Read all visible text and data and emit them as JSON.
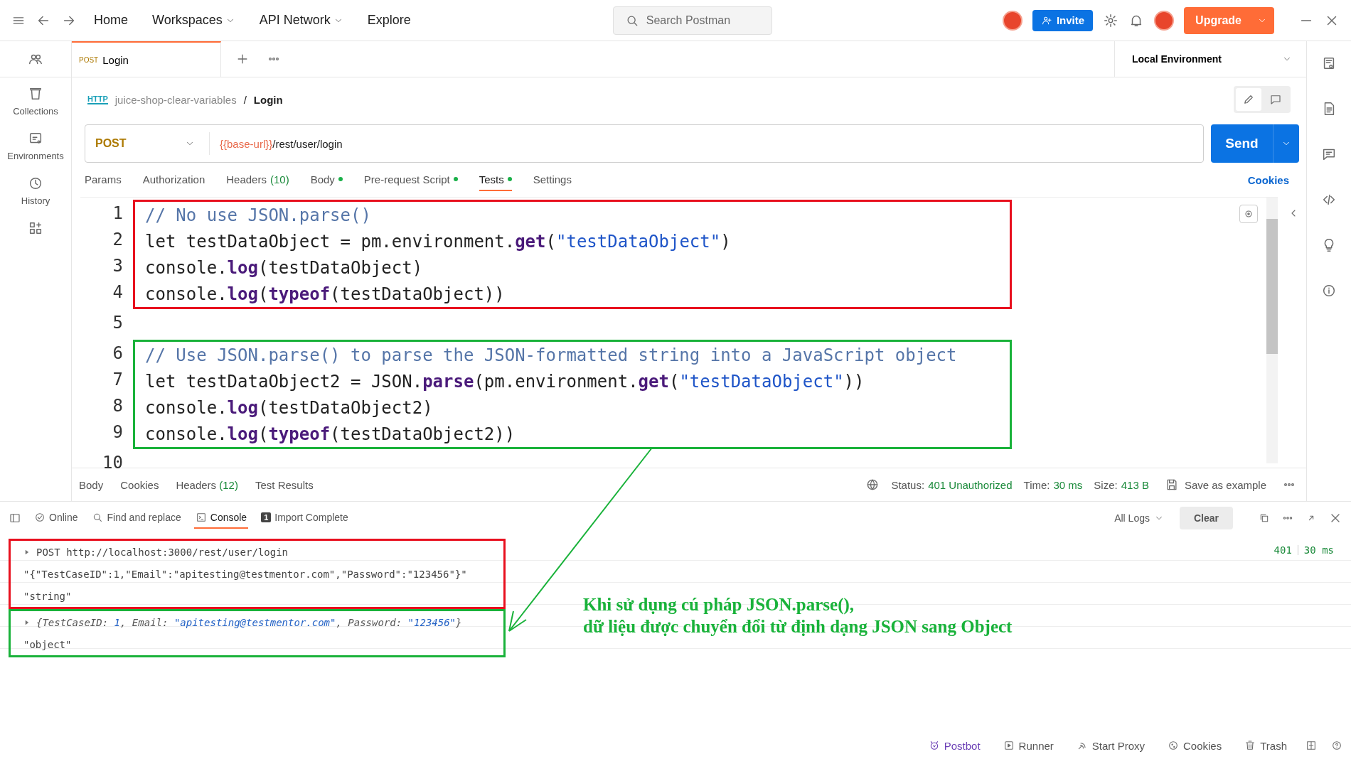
{
  "top_bar": {
    "nav": [
      {
        "label": "Home",
        "dropdown": false
      },
      {
        "label": "Workspaces",
        "dropdown": true
      },
      {
        "label": "API Network",
        "dropdown": true
      },
      {
        "label": "Explore",
        "dropdown": false
      }
    ],
    "search": {
      "placeholder": "Search Postman"
    },
    "invite": "Invite",
    "upgrade": "Upgrade"
  },
  "sidebar": {
    "items": [
      {
        "label": "Collections"
      },
      {
        "label": "Environments"
      },
      {
        "label": "History"
      }
    ]
  },
  "tabs": [
    {
      "method": "POST",
      "name": "Login",
      "selected": true
    }
  ],
  "environment": "Local Environment",
  "breadcrumb": {
    "protocol": "HTTP",
    "items": [
      "juice-shop-clear-variables",
      "Login"
    ],
    "separator": "/"
  },
  "request": {
    "method": "POST",
    "url": [
      {
        "text": "{{base-url}}",
        "kind": "variable"
      },
      {
        "text": "/rest/user/login",
        "kind": "path"
      }
    ],
    "send": "Send"
  },
  "request_tabs": [
    {
      "label": "Params",
      "selected": false,
      "indicator": false
    },
    {
      "label": "Authorization",
      "selected": false,
      "indicator": false
    },
    {
      "label": "Headers",
      "count": "(10)",
      "selected": false,
      "indicator": false
    },
    {
      "label": "Body",
      "selected": false,
      "indicator": true
    },
    {
      "label": "Pre-request Script",
      "selected": false,
      "indicator": true
    },
    {
      "label": "Tests",
      "selected": true,
      "indicator": true
    },
    {
      "label": "Settings",
      "selected": false,
      "indicator": false
    }
  ],
  "cookies_link": "Cookies",
  "editor": {
    "blocks": [
      {
        "color": "#e8101e",
        "lines": [
          {
            "number": "1",
            "segments": [
              {
                "text": "// No use JSON.parse()",
                "kind": "comment"
              }
            ]
          },
          {
            "number": "2",
            "segments": [
              {
                "text": "let testDataObject = pm.environment.",
                "kind": "plain"
              },
              {
                "text": "get",
                "kind": "method"
              },
              {
                "text": "(",
                "kind": "plain"
              },
              {
                "text": "\"testDataObject\"",
                "kind": "string"
              },
              {
                "text": ")",
                "kind": "plain"
              }
            ]
          },
          {
            "number": "3",
            "segments": [
              {
                "text": "console.",
                "kind": "plain"
              },
              {
                "text": "log",
                "kind": "method"
              },
              {
                "text": "(testDataObject)",
                "kind": "plain"
              }
            ]
          },
          {
            "number": "4",
            "segments": [
              {
                "text": "console.",
                "kind": "plain"
              },
              {
                "text": "log",
                "kind": "method"
              },
              {
                "text": "(",
                "kind": "plain"
              },
              {
                "text": "typeof",
                "kind": "method"
              },
              {
                "text": "(testDataObject))",
                "kind": "plain"
              }
            ]
          }
        ]
      },
      {
        "lines": [
          {
            "number": "5"
          }
        ]
      },
      {
        "color": "#19b23a",
        "lines": [
          {
            "number": "6",
            "segments": [
              {
                "text": "// Use JSON.parse() to parse the JSON-formatted string into a JavaScript object",
                "kind": "comment"
              }
            ]
          },
          {
            "number": "7",
            "segments": [
              {
                "text": "let testDataObject2 = JSON.",
                "kind": "plain"
              },
              {
                "text": "parse",
                "kind": "method"
              },
              {
                "text": "(pm.environment.",
                "kind": "plain"
              },
              {
                "text": "get",
                "kind": "method"
              },
              {
                "text": "(",
                "kind": "plain"
              },
              {
                "text": "\"testDataObject\"",
                "kind": "string"
              },
              {
                "text": "))",
                "kind": "plain"
              }
            ]
          },
          {
            "number": "8",
            "segments": [
              {
                "text": "console.",
                "kind": "plain"
              },
              {
                "text": "log",
                "kind": "method"
              },
              {
                "text": "(testDataObject2)",
                "kind": "plain"
              }
            ]
          },
          {
            "number": "9",
            "segments": [
              {
                "text": "console.",
                "kind": "plain"
              },
              {
                "text": "log",
                "kind": "method"
              },
              {
                "text": "(",
                "kind": "plain"
              },
              {
                "text": "typeof",
                "kind": "method"
              },
              {
                "text": "(testDataObject2))",
                "kind": "plain"
              }
            ]
          }
        ]
      },
      {
        "lines": [
          {
            "number": "10"
          }
        ]
      }
    ]
  },
  "response": {
    "tabs": [
      {
        "label": "Body"
      },
      {
        "label": "Cookies"
      },
      {
        "label": "Headers",
        "count": "(12)"
      },
      {
        "label": "Test Results"
      }
    ],
    "stats": [
      {
        "label": "Status:",
        "value": "401 Unauthorized"
      },
      {
        "label": "Time:",
        "value": "30 ms"
      },
      {
        "label": "Size:",
        "value": "413 B"
      }
    ],
    "save": "Save as example"
  },
  "console": {
    "toolbar": [
      {
        "label": "Online",
        "selected": false
      },
      {
        "label": "Find and replace",
        "selected": false
      },
      {
        "label": "Console",
        "selected": true
      },
      {
        "label": "Import Complete",
        "badge": "1",
        "selected": false
      }
    ],
    "filter": "All Logs",
    "clear": "Clear",
    "blocks": [
      {
        "color": "#e8101e",
        "entries": [
          {
            "expandable": true,
            "segments": [
              {
                "text": "POST http://localhost:3000/rest/user/login",
                "kind": "plain"
              }
            ],
            "status": "401",
            "time": "30 ms"
          },
          {
            "expandable": false,
            "segments": [
              {
                "text": "\"{\"TestCaseID\":1,\"Email\":\"apitesting@testmentor.com\",\"Password\":\"123456\"}\"",
                "kind": "plain"
              }
            ]
          },
          {
            "expandable": false,
            "segments": [
              {
                "text": "\"string\"",
                "kind": "plain"
              }
            ]
          }
        ]
      },
      {
        "color": "#19b23a",
        "entries": [
          {
            "expandable": true,
            "segments": [
              {
                "text": "{TestCaseID: ",
                "kind": "key"
              },
              {
                "text": "1",
                "kind": "value"
              },
              {
                "text": ", Email: ",
                "kind": "key"
              },
              {
                "text": "\"apitesting@testmentor.com\"",
                "kind": "value"
              },
              {
                "text": ", Password: ",
                "kind": "key"
              },
              {
                "text": "\"123456\"",
                "kind": "value"
              },
              {
                "text": "}",
                "kind": "key"
              }
            ]
          },
          {
            "expandable": false,
            "segments": [
              {
                "text": "\"object\"",
                "kind": "plain"
              }
            ]
          }
        ]
      }
    ]
  },
  "annotation": {
    "lines": [
      "Khi sử dụng cú pháp JSON.parse(),",
      "dữ liệu được chuyển đổi từ định dạng JSON sang Object"
    ]
  },
  "footer": [
    {
      "label": "Postbot",
      "accent": true
    },
    {
      "label": "Runner",
      "accent": false
    },
    {
      "label": "Start Proxy",
      "accent": false
    },
    {
      "label": "Cookies",
      "accent": false
    },
    {
      "label": "Trash",
      "accent": false
    }
  ]
}
